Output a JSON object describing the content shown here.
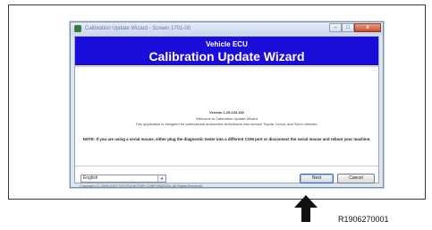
{
  "window": {
    "title": "Calibration Update Wizard - Screen 1701-00",
    "controls": {
      "minimize": "–",
      "maximize": "□",
      "close": "x"
    }
  },
  "banner": {
    "subtitle": "Vehicle ECU",
    "title": "Calibration Update Wizard"
  },
  "content": {
    "version": "Version 1.29.133.182",
    "welcome": "Welcome to Calibration Update Wizard",
    "description": "This application is designed for professional automotive technicians who service Toyota, Lexus, and Scion vehicles.",
    "note": "NOTE: If you are using a serial mouse, either plug the diagnostic tester into a different COM port or disconnect the serial mouse and reboot your machine."
  },
  "footer": {
    "language": "English",
    "copyright": "Copyright (C) 2009-2015 TOYOTA MOTOR CORPORATION. All Rights Reserved.",
    "next_label": "Next",
    "cancel_label": "Cancel"
  },
  "figure_id": "R1906270001",
  "colors": {
    "banner": "#1a0dd9",
    "close_button": "#c94a2e"
  },
  "icons": {
    "app": "app-icon",
    "pointer": "arrow-up-icon"
  }
}
